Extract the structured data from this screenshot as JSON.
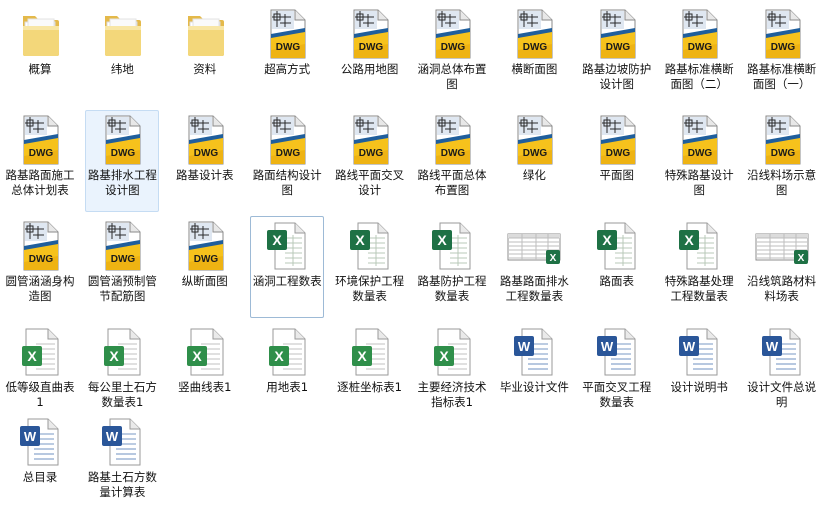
{
  "window": {
    "view": "large-icons"
  },
  "files": [
    {
      "name": "概算",
      "type": "folder",
      "icon": "folder-icon"
    },
    {
      "name": "纬地",
      "type": "folder",
      "icon": "folder-icon"
    },
    {
      "name": "资料",
      "type": "folder",
      "icon": "folder-icon"
    },
    {
      "name": "超高方式",
      "type": "dwg",
      "icon": "dwg-file-icon"
    },
    {
      "name": "公路用地图",
      "type": "dwg",
      "icon": "dwg-file-icon"
    },
    {
      "name": "涵洞总体布置图",
      "type": "dwg",
      "icon": "dwg-file-icon"
    },
    {
      "name": "横断面图",
      "type": "dwg",
      "icon": "dwg-file-icon"
    },
    {
      "name": "路基边坡防护设计图",
      "type": "dwg",
      "icon": "dwg-file-icon"
    },
    {
      "name": "路基标准横断面图（二）",
      "type": "dwg",
      "icon": "dwg-file-icon"
    },
    {
      "name": "路基标准横断面图（一）",
      "type": "dwg",
      "icon": "dwg-file-icon"
    },
    {
      "name": "路基路面施工总体计划表",
      "type": "dwg",
      "icon": "dwg-file-icon"
    },
    {
      "name": "路基排水工程设计图",
      "type": "dwg",
      "icon": "dwg-file-icon",
      "selected": true
    },
    {
      "name": "路基设计表",
      "type": "dwg",
      "icon": "dwg-file-icon"
    },
    {
      "name": "路面结构设计图",
      "type": "dwg",
      "icon": "dwg-file-icon"
    },
    {
      "name": "路线平面交叉设计",
      "type": "dwg",
      "icon": "dwg-file-icon"
    },
    {
      "name": "路线平面总体布置图",
      "type": "dwg",
      "icon": "dwg-file-icon"
    },
    {
      "name": "绿化",
      "type": "dwg",
      "icon": "dwg-file-icon"
    },
    {
      "name": "平面图",
      "type": "dwg",
      "icon": "dwg-file-icon"
    },
    {
      "name": "特殊路基设计图",
      "type": "dwg",
      "icon": "dwg-file-icon"
    },
    {
      "name": "沿线料场示意图",
      "type": "dwg",
      "icon": "dwg-file-icon"
    },
    {
      "name": "圆管涵涵身构造图",
      "type": "dwg",
      "icon": "dwg-file-icon"
    },
    {
      "name": "圆管涵预制管节配筋图",
      "type": "dwg",
      "icon": "dwg-file-icon"
    },
    {
      "name": "纵断面图",
      "type": "dwg",
      "icon": "dwg-file-icon"
    },
    {
      "name": "涵洞工程数表",
      "type": "xls",
      "icon": "excel-file-icon",
      "focused": true
    },
    {
      "name": "环境保护工程数量表",
      "type": "xls",
      "icon": "excel-file-icon"
    },
    {
      "name": "路基防护工程数量表",
      "type": "xls",
      "icon": "excel-file-icon"
    },
    {
      "name": "路基路面排水工程数量表",
      "type": "xls-thumb",
      "icon": "excel-thumbnail-icon"
    },
    {
      "name": "路面表",
      "type": "xls",
      "icon": "excel-file-icon"
    },
    {
      "name": "特殊路基处理工程数量表",
      "type": "xls",
      "icon": "excel-file-icon"
    },
    {
      "name": "沿线筑路材料料场表",
      "type": "xls-thumb",
      "icon": "excel-thumbnail-icon"
    },
    {
      "name": "低等级直曲表1",
      "type": "xls-old",
      "icon": "excel-legacy-icon"
    },
    {
      "name": "每公里土石方数量表1",
      "type": "xls-old",
      "icon": "excel-legacy-icon"
    },
    {
      "name": "竖曲线表1",
      "type": "xls-old",
      "icon": "excel-legacy-icon"
    },
    {
      "name": "用地表1",
      "type": "xls-old",
      "icon": "excel-legacy-icon"
    },
    {
      "name": "逐桩坐标表1",
      "type": "xls-old",
      "icon": "excel-legacy-icon"
    },
    {
      "name": "主要经济技术指标表1",
      "type": "xls-old",
      "icon": "excel-legacy-icon"
    },
    {
      "name": "毕业设计文件",
      "type": "doc",
      "icon": "word-file-icon"
    },
    {
      "name": "平面交叉工程数量表",
      "type": "doc",
      "icon": "word-file-icon"
    },
    {
      "name": "设计说明书",
      "type": "doc",
      "icon": "word-file-icon"
    },
    {
      "name": "设计文件总说明",
      "type": "doc",
      "icon": "word-file-icon"
    },
    {
      "name": "总目录",
      "type": "doc",
      "icon": "word-file-icon"
    },
    {
      "name": "路基土石方数量计算表",
      "type": "doc",
      "icon": "word-file-icon"
    }
  ],
  "icon_text": {
    "dwg": "DWG"
  },
  "colors": {
    "folder": "#f3d77a",
    "dwg_yellow": "#f6c21c",
    "dwg_blue": "#1f5e9c",
    "excel_green": "#1e7145",
    "word_blue": "#2a5699",
    "selection": "#eaf3fd"
  }
}
